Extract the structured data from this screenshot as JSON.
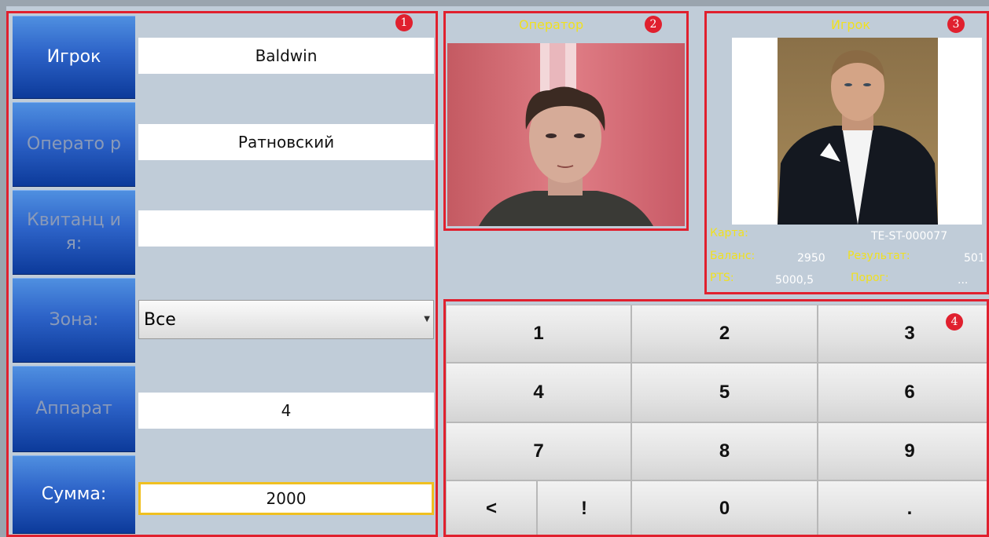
{
  "sidebar": {
    "player_label": "Игрок",
    "operator_label": "Операто р",
    "receipt_label": "Квитанц ия:",
    "zone_label": "Зона:",
    "machine_label": "Аппарат",
    "amount_label": "Сумма:"
  },
  "form": {
    "player_value": "Baldwin",
    "operator_value": "Ратновский",
    "receipt_value": "",
    "zone_selected": "Все",
    "machine_value": "4",
    "amount_value": "2000"
  },
  "operator_panel": {
    "title": "Оператор"
  },
  "player_panel": {
    "title": "Игрок",
    "card_label": "Карта:",
    "card_value": "TE-ST-000077",
    "balance_label": "Баланс:",
    "balance_value": "2950",
    "result_label": "Результат:",
    "result_value": "501",
    "pts_label": "PTS:",
    "pts_value": "5000,5",
    "threshold_label": "Порог:",
    "threshold_value": "..."
  },
  "keypad": {
    "k1": "1",
    "k2": "2",
    "k3": "3",
    "k4": "4",
    "k5": "5",
    "k6": "6",
    "k7": "7",
    "k8": "8",
    "k9": "9",
    "back": "<",
    "excl": "!",
    "k0": "0",
    "dot": "."
  },
  "badges": {
    "b1": "1",
    "b2": "2",
    "b3": "3",
    "b4": "4"
  },
  "colors": {
    "accent_red": "#e0202e",
    "title_yellow": "#f0e020",
    "button_blue": "#0c3a9a"
  }
}
